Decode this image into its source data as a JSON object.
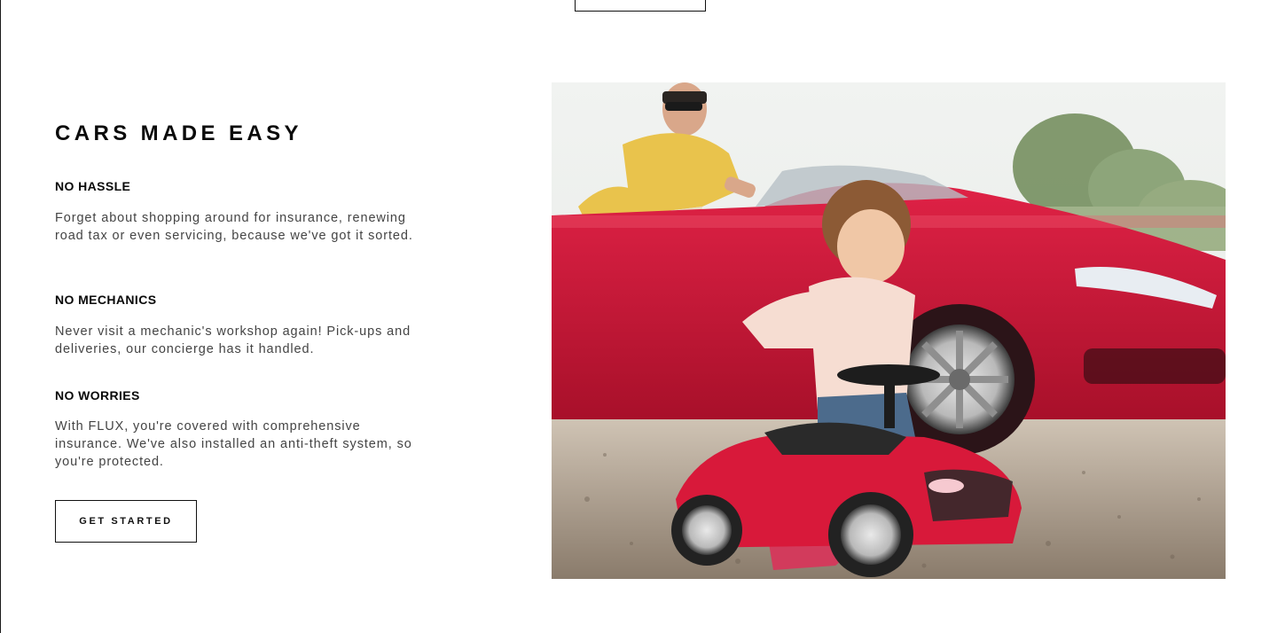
{
  "section": {
    "title": "CARS MADE EASY"
  },
  "features": [
    {
      "heading": "NO HASSLE",
      "text": "Forget about shopping around for insurance, renewing road tax or even servicing, because we've got it sorted."
    },
    {
      "heading": "NO MECHANICS",
      "text": "Never visit a mechanic's workshop again! Pick-ups and deliveries, our concierge has it handled."
    },
    {
      "heading": "NO WORRIES",
      "text": "With FLUX, you're covered with comprehensive insurance. We've also installed an anti-theft system, so you're protected."
    }
  ],
  "cta": {
    "label": "GET STARTED"
  },
  "colors": {
    "car_red": "#d8193a",
    "text_dark": "#0a0a0a",
    "text_body": "#444444"
  }
}
